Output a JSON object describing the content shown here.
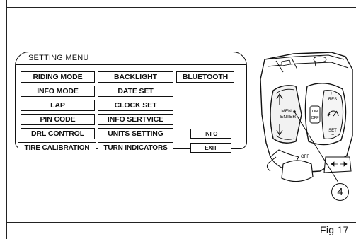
{
  "setting_menu": {
    "title": "SETTING MENU",
    "items": {
      "riding_mode": "RIDING MODE",
      "backlight": "BACKLIGHT",
      "bluetooth": "BLUETOOTH",
      "info_mode": "INFO MODE",
      "date_set": "DATE SET",
      "lap": "LAP",
      "clock_set": "CLOCK SET",
      "pin_code": "PIN CODE",
      "info_service": "INFO SERTVICE",
      "drl_control": "DRL CONTROL",
      "units_setting": "UNITS SETTING",
      "info": "INFO",
      "tire_calibration": "TIRE CALIBRATION",
      "turn_indicators": "TURN INDICATORS",
      "exit": "EXIT"
    }
  },
  "controls": {
    "menu_label_1": "MENU",
    "menu_label_2": "ENTER",
    "on_label": "ON",
    "off_label": "OFF",
    "res_label": "RES",
    "set_label": "SET",
    "plus_label": "+",
    "minus_label": "−",
    "off_switch_label": "OFF",
    "up_icon": "up-arrow-icon",
    "down_icon": "down-arrow-icon",
    "cruise_icon": "cruise-control-icon",
    "turn_left_icon": "turn-left-arrow-icon",
    "turn_right_icon": "turn-right-arrow-icon"
  },
  "callout": "4",
  "figure_label": "Fig 17"
}
